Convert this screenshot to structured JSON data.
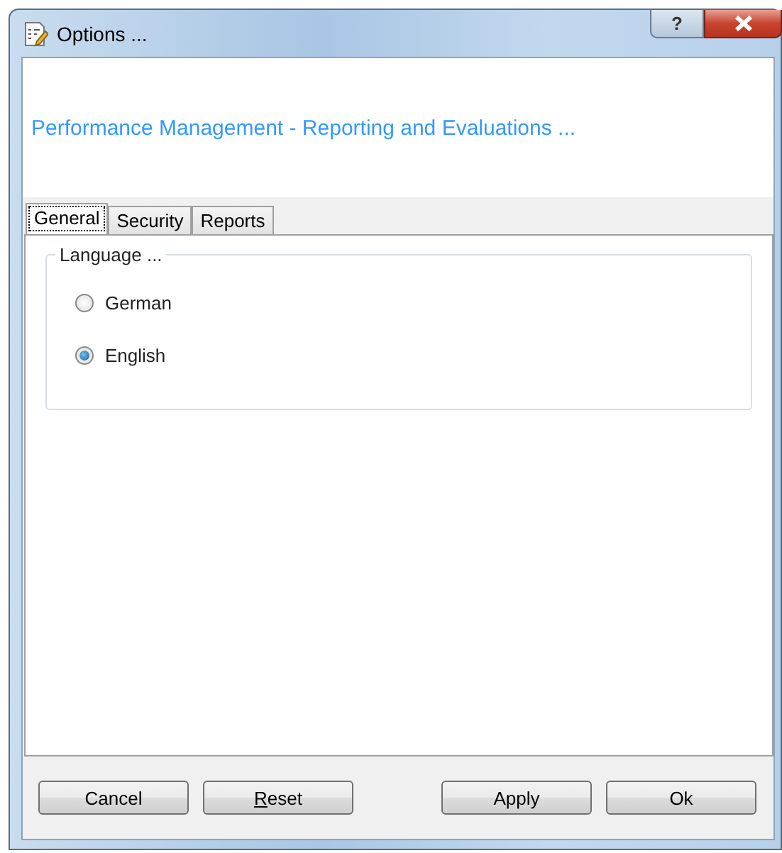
{
  "window": {
    "title": "Options ...",
    "help": "?"
  },
  "header": {
    "text": "Performance Management - Reporting and Evaluations ..."
  },
  "tabs": [
    {
      "label": "General",
      "selected": true
    },
    {
      "label": "Security",
      "selected": false
    },
    {
      "label": "Reports",
      "selected": false
    }
  ],
  "language_group": {
    "title": "Language ...",
    "options": [
      {
        "label": "German",
        "selected": false
      },
      {
        "label": "English",
        "selected": true
      }
    ]
  },
  "buttons": [
    {
      "label": "Cancel"
    },
    {
      "label": "Reset",
      "access_key_underlined": true
    },
    {
      "label": "Apply"
    },
    {
      "label": "Ok"
    }
  ]
}
